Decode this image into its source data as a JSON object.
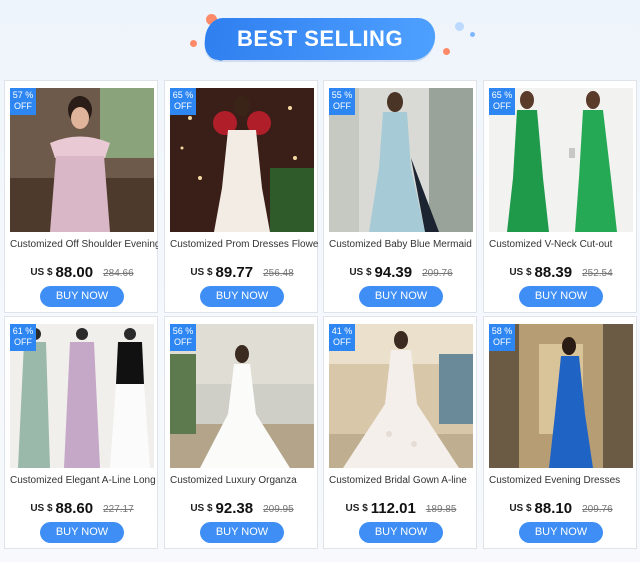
{
  "header": {
    "title": "BEST SELLING"
  },
  "colors": {
    "accent": "#2d86f2",
    "button": "#3e8ef5"
  },
  "products": [
    {
      "discount": "57 %",
      "off": "OFF",
      "title": "Customized Off Shoulder Evening",
      "currency": "US $",
      "price": "88.00",
      "old_price": "284.66",
      "button": "BUY NOW"
    },
    {
      "discount": "65 %",
      "off": "OFF",
      "title": "Customized Prom Dresses Flower",
      "currency": "US $",
      "price": "89.77",
      "old_price": "256.48",
      "button": "BUY NOW"
    },
    {
      "discount": "55 %",
      "off": "OFF",
      "title": "Customized Baby Blue Mermaid",
      "currency": "US $",
      "price": "94.39",
      "old_price": "209.76",
      "button": "BUY NOW"
    },
    {
      "discount": "65 %",
      "off": "OFF",
      "title": "Customized V-Neck Cut-out",
      "currency": "US $",
      "price": "88.39",
      "old_price": "252.54",
      "button": "BUY NOW"
    },
    {
      "discount": "61 %",
      "off": "OFF",
      "title": "Customized Elegant A-Line Long",
      "currency": "US $",
      "price": "88.60",
      "old_price": "227.17",
      "button": "BUY NOW"
    },
    {
      "discount": "56 %",
      "off": "OFF",
      "title": "Customized Luxury Organza",
      "currency": "US $",
      "price": "92.38",
      "old_price": "209.95",
      "button": "BUY NOW"
    },
    {
      "discount": "41 %",
      "off": "OFF",
      "title": "Customized Bridal Gown A-line",
      "currency": "US $",
      "price": "112.01",
      "old_price": "189.85",
      "button": "BUY NOW"
    },
    {
      "discount": "58 %",
      "off": "OFF",
      "title": "Customized Evening Dresses",
      "currency": "US $",
      "price": "88.10",
      "old_price": "209.76",
      "button": "BUY NOW"
    }
  ]
}
